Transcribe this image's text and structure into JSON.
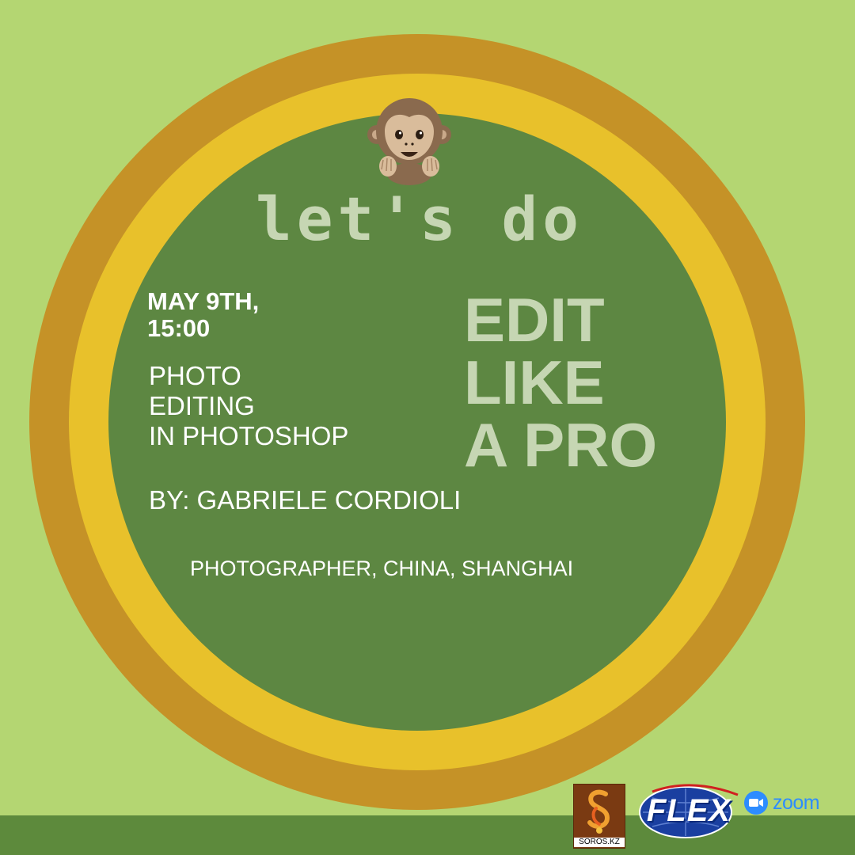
{
  "poster": {
    "lets_do": "let's do",
    "date_line1": "MAY 9TH,",
    "date_line2": "15:00",
    "topic_line1": "PHOTO",
    "topic_line2": "EDITING",
    "topic_line3": "IN PHOTOSHOP",
    "headline_line1": "EDIT",
    "headline_line2": "LIKE",
    "headline_line3": "A PRO",
    "speaker": "BY: GABRIELE CORDIOLI",
    "role": "PHOTOGRAPHER, CHINA, SHANGHAI",
    "icon": "see-no-evil-monkey-icon"
  },
  "logos": {
    "soros": "SOROS.KZ",
    "flex": "FLEX",
    "zoom": "zoom"
  },
  "colors": {
    "background": "#b4d672",
    "outer_ring": "#c59227",
    "middle_ring": "#e8c12b",
    "disc": "#5d8742",
    "accent_text": "#c6d6b3",
    "bottom_band": "#5d8a3c"
  }
}
